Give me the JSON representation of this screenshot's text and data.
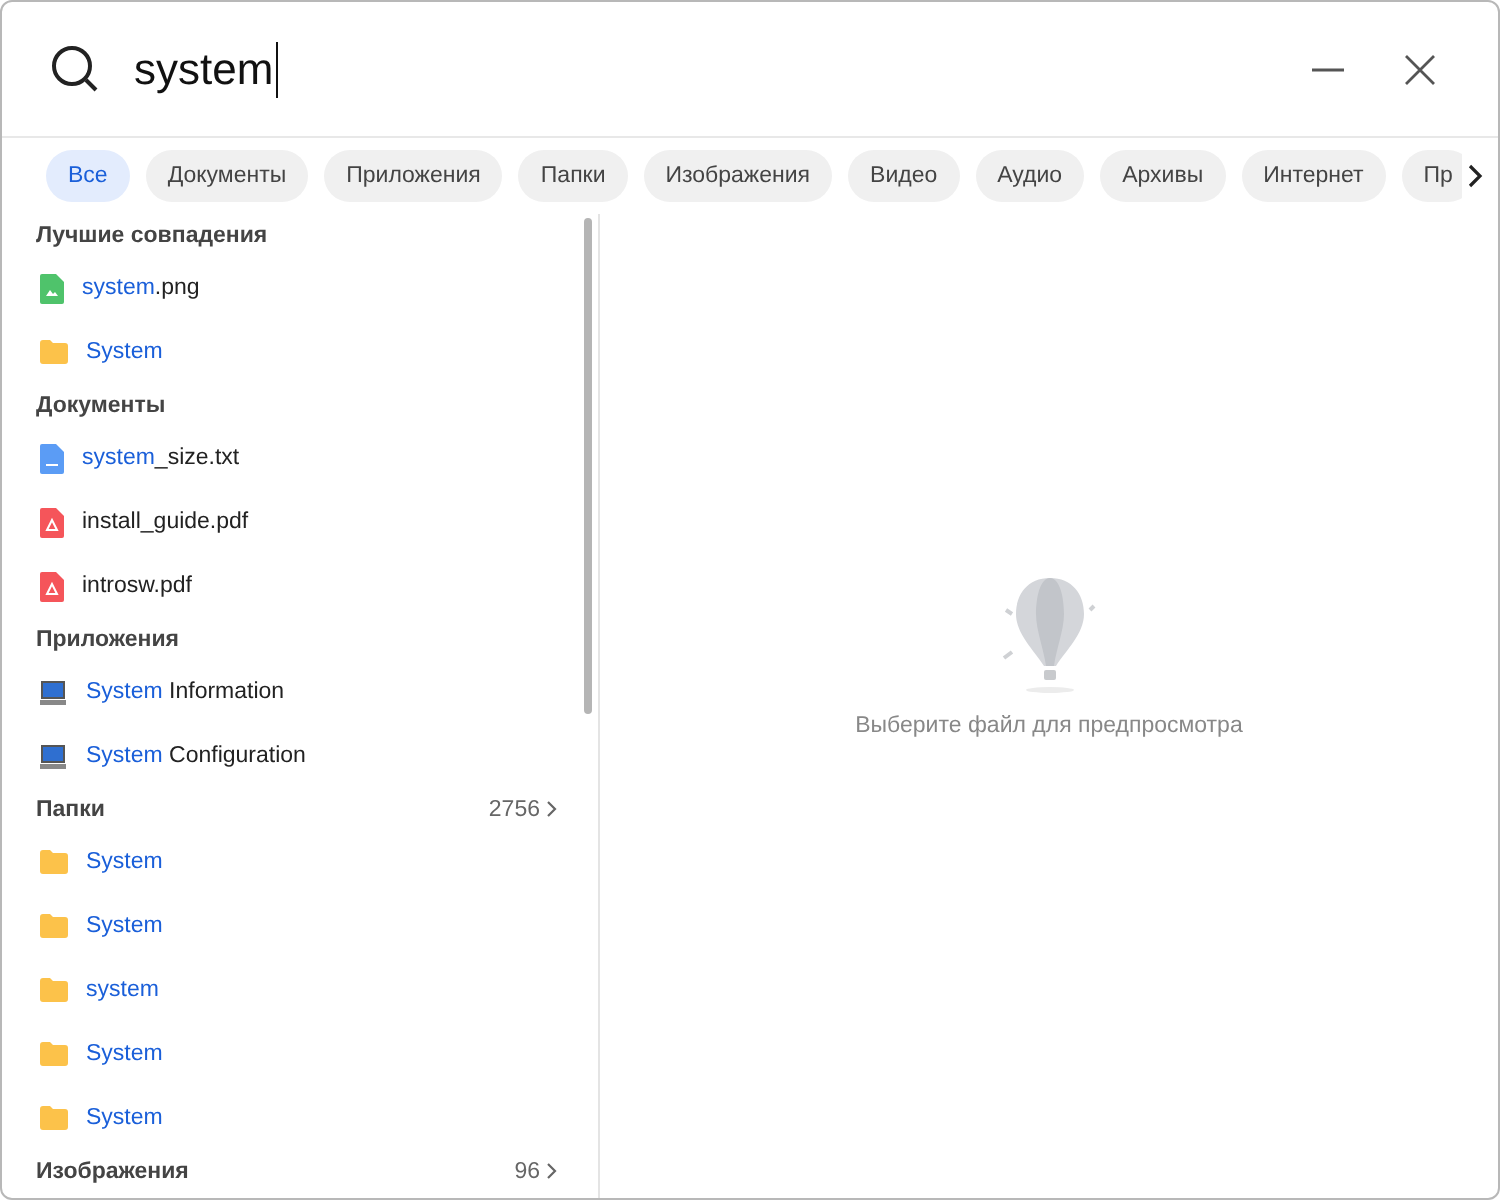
{
  "search": {
    "value": "system"
  },
  "filters": [
    {
      "label": "Все",
      "selected": true
    },
    {
      "label": "Документы",
      "selected": false
    },
    {
      "label": "Приложения",
      "selected": false
    },
    {
      "label": "Папки",
      "selected": false
    },
    {
      "label": "Изображения",
      "selected": false
    },
    {
      "label": "Видео",
      "selected": false
    },
    {
      "label": "Аудио",
      "selected": false
    },
    {
      "label": "Архивы",
      "selected": false
    },
    {
      "label": "Интернет",
      "selected": false
    },
    {
      "label": "Пр",
      "selected": false
    }
  ],
  "sections": [
    {
      "title": "Лучшие совпадения",
      "items": [
        {
          "kind": "image",
          "match": "system",
          "rest": ".png"
        },
        {
          "kind": "folder",
          "match": "System"
        }
      ]
    },
    {
      "title": "Документы",
      "items": [
        {
          "kind": "text",
          "match": "system",
          "rest": "_size.txt"
        },
        {
          "kind": "pdf",
          "rest": "install_guide.pdf"
        },
        {
          "kind": "pdf",
          "rest": "introsw.pdf"
        }
      ]
    },
    {
      "title": "Приложения",
      "items": [
        {
          "kind": "app",
          "match": "System",
          "rest": " Information"
        },
        {
          "kind": "app",
          "match": "System",
          "rest": " Configuration"
        }
      ]
    },
    {
      "title": "Папки",
      "count": "2756",
      "items": [
        {
          "kind": "folder",
          "match": "System"
        },
        {
          "kind": "folder",
          "match": "System"
        },
        {
          "kind": "folder",
          "match": "system"
        },
        {
          "kind": "folder",
          "match": "System"
        },
        {
          "kind": "folder",
          "match": "System"
        }
      ]
    },
    {
      "title": "Изображения",
      "count": "96"
    }
  ],
  "preview": {
    "message": "Выберите файл для предпросмотра"
  }
}
